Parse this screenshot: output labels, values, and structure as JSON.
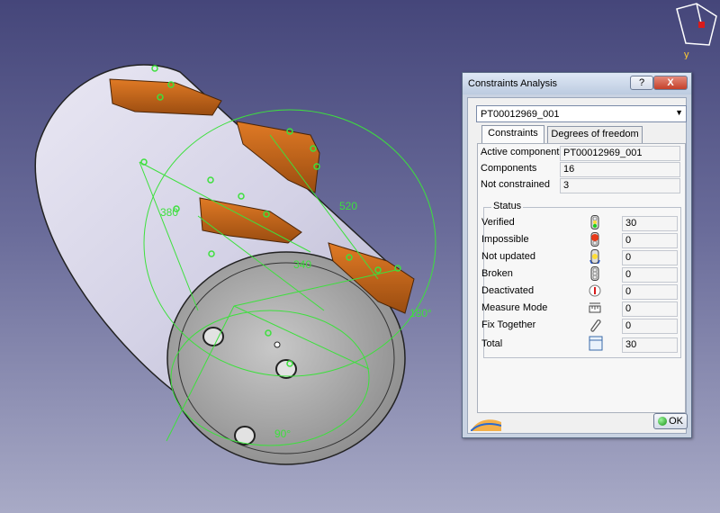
{
  "viewport": {
    "dimensions": [
      "520",
      "380",
      "340",
      "180°",
      "90°"
    ]
  },
  "compass": {
    "axis_label": "y"
  },
  "dialog": {
    "title": "Constraints Analysis",
    "help_label": "?",
    "close_label": "X",
    "component_select": "PT00012969_001",
    "tabs": [
      {
        "label": "Constraints",
        "active": true
      },
      {
        "label": "Degrees of freedom",
        "active": false
      }
    ],
    "active_component_label": "Active component",
    "active_component_value": "PT00012969_001",
    "components_label": "Components",
    "components_value": "16",
    "not_constrained_label": "Not constrained",
    "not_constrained_value": "3",
    "status_legend": "Status",
    "status": [
      {
        "label": "Verified",
        "value": "30",
        "icon": "verified-traffic-light-icon"
      },
      {
        "label": "Impossible",
        "value": "0",
        "icon": "impossible-traffic-light-icon"
      },
      {
        "label": "Not updated",
        "value": "0",
        "icon": "not-updated-icon"
      },
      {
        "label": "Broken",
        "value": "0",
        "icon": "broken-traffic-light-icon"
      },
      {
        "label": "Deactivated",
        "value": "0",
        "icon": "deactivated-icon"
      },
      {
        "label": "Measure Mode",
        "value": "0",
        "icon": "measure-mode-icon"
      },
      {
        "label": "Fix Together",
        "value": "0",
        "icon": "fix-together-icon"
      },
      {
        "label": "Total",
        "value": "30",
        "icon": "total-icon"
      }
    ],
    "ok_label": "OK"
  },
  "colors": {
    "viewport_top": "#45467a",
    "viewport_bottom": "#a8aac6",
    "constraint_green": "#3de03d",
    "bracket_orange": "#c8661a"
  }
}
